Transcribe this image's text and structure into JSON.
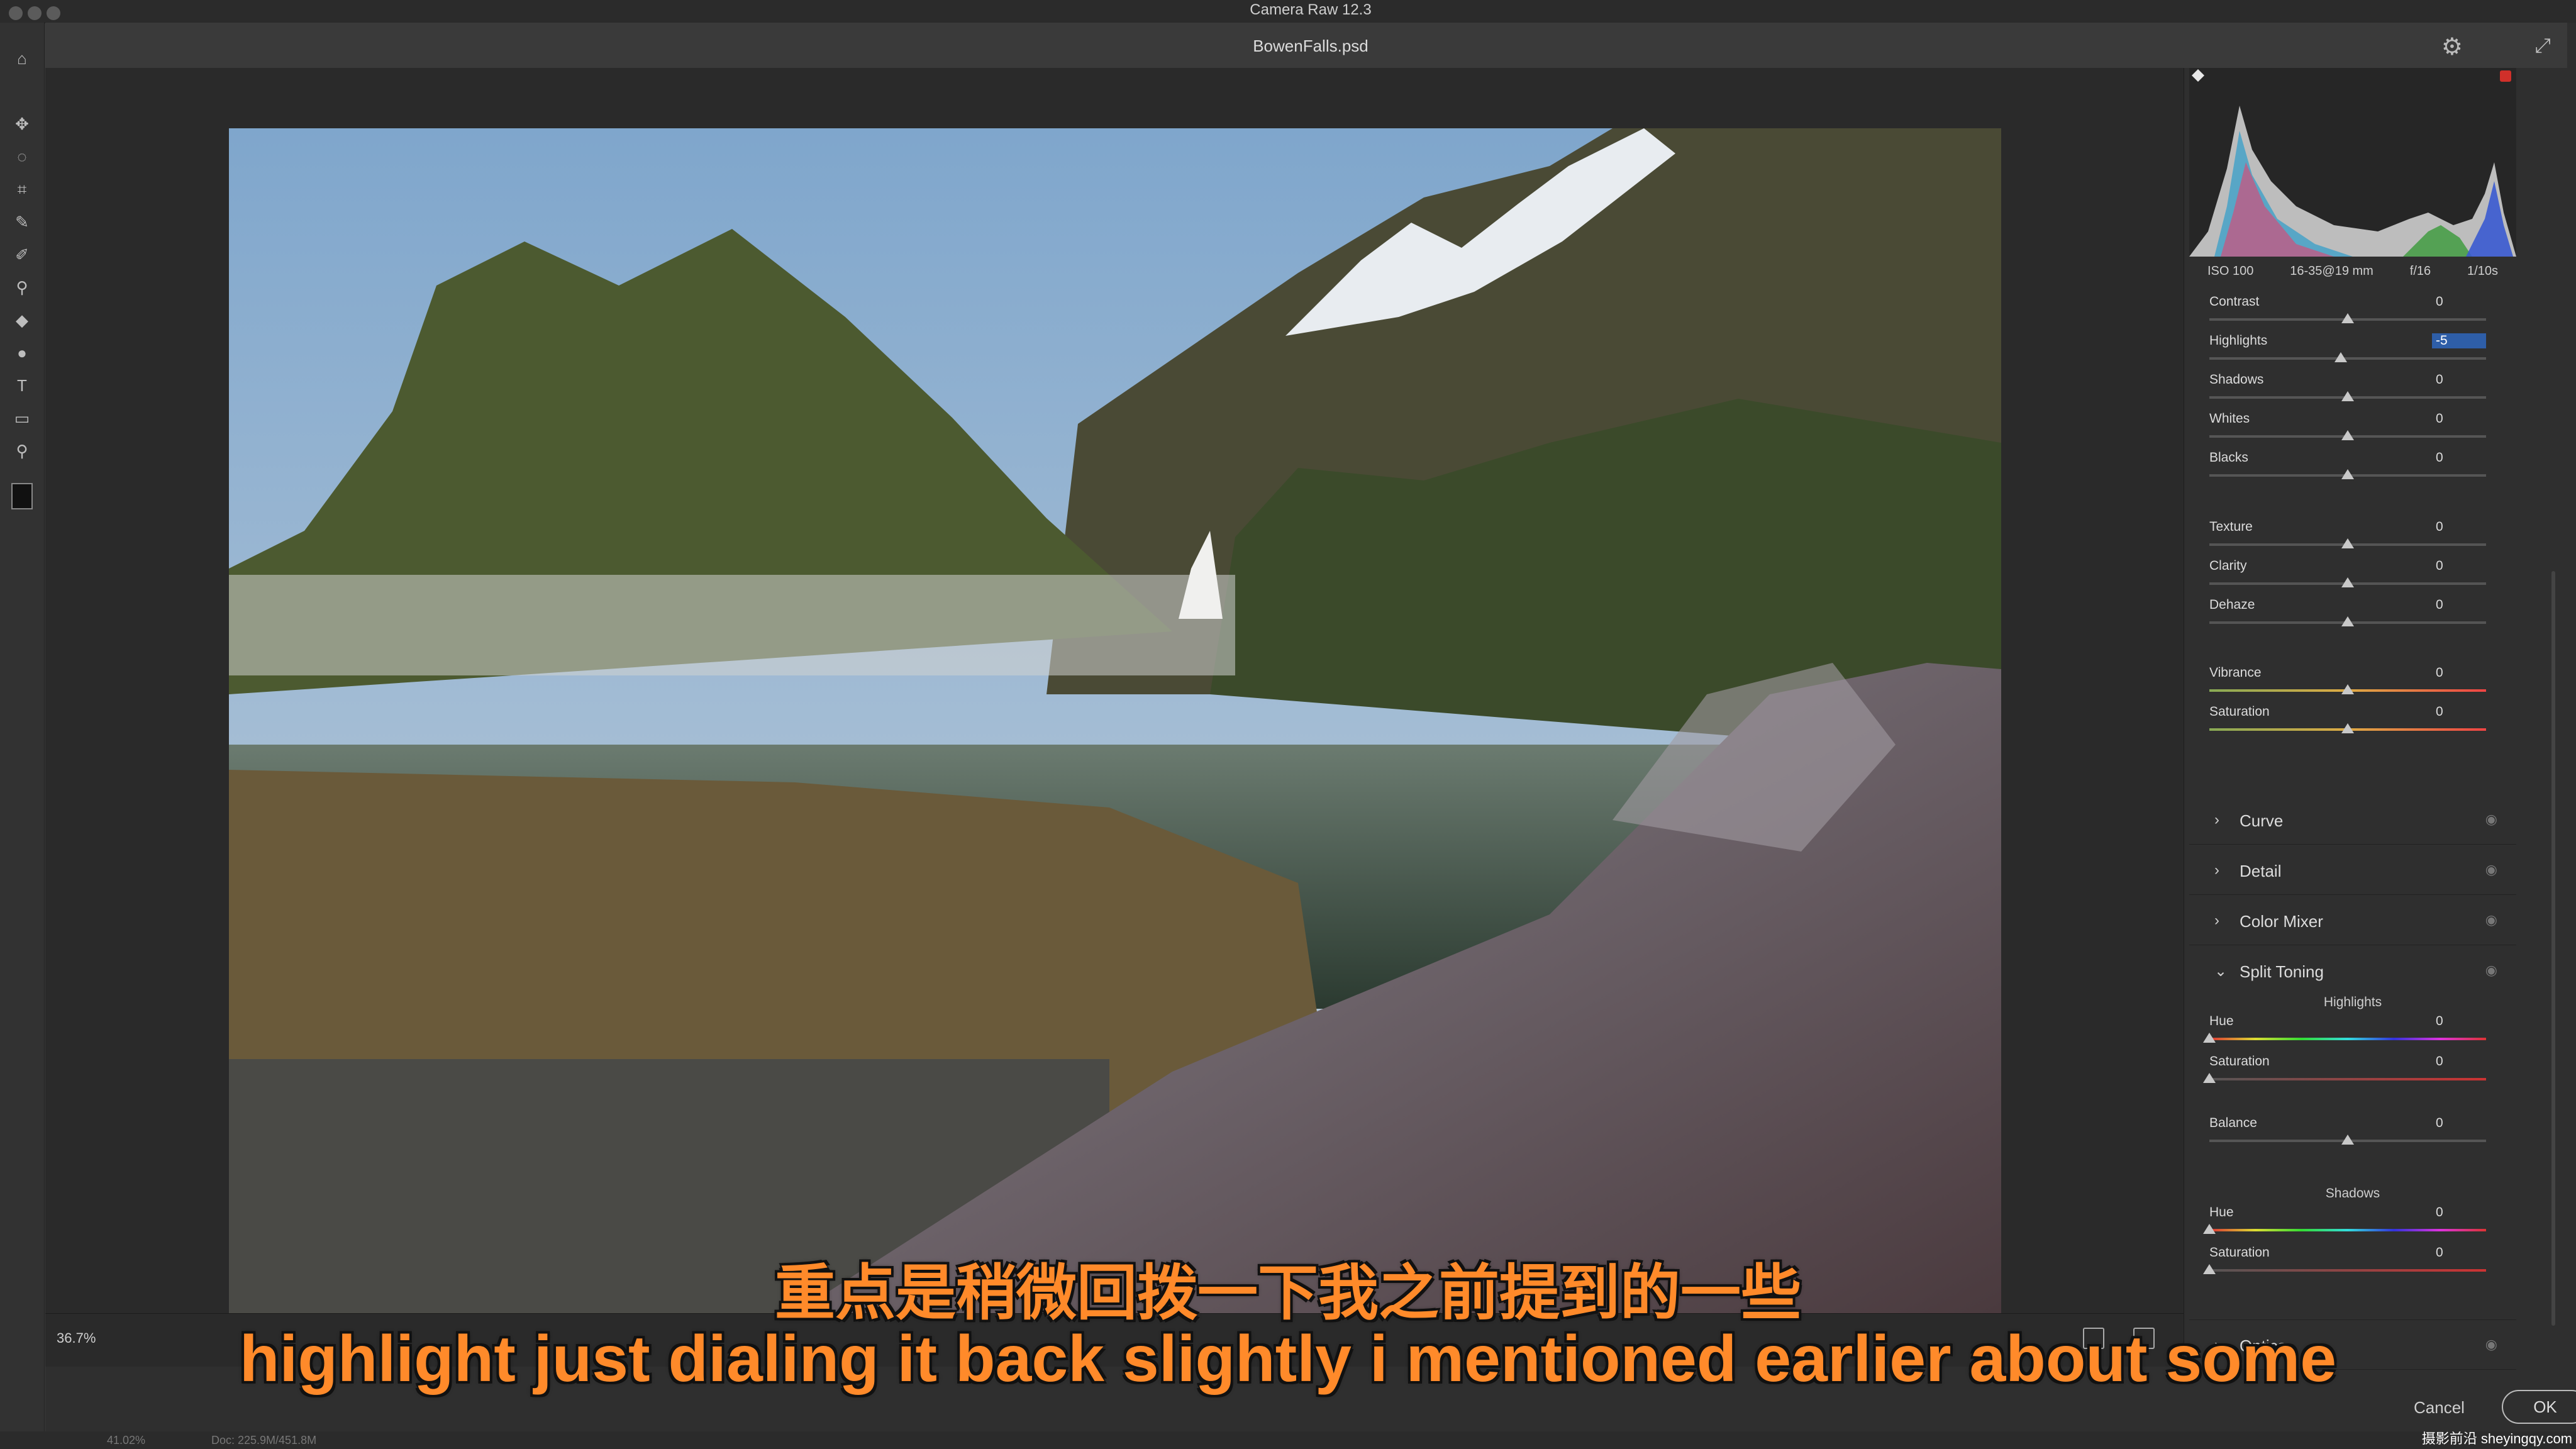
{
  "app": {
    "window_title": "Camera Raw 12.3",
    "document_title": "BowenFalls.psd"
  },
  "exif": {
    "iso": "ISO 100",
    "lens": "16-35@19 mm",
    "aperture": "f/16",
    "shutter": "1/10s"
  },
  "basic_sliders": [
    {
      "label": "Contrast",
      "value": "0",
      "level": 0.5
    },
    {
      "label": "Highlights",
      "value": "-5",
      "level": 0.475
    },
    {
      "label": "Shadows",
      "value": "0",
      "level": 0.5
    },
    {
      "label": "Whites",
      "value": "0",
      "level": 0.5
    },
    {
      "label": "Blacks",
      "value": "0",
      "level": 0.5
    },
    {
      "label": "Texture",
      "value": "0",
      "level": 0.5
    },
    {
      "label": "Clarity",
      "value": "0",
      "level": 0.5
    },
    {
      "label": "Dehaze",
      "value": "0",
      "level": 0.5
    },
    {
      "label": "Vibrance",
      "value": "0",
      "level": 0.5
    },
    {
      "label": "Saturation",
      "value": "0",
      "level": 0.5
    }
  ],
  "sections": {
    "curve": "Curve",
    "detail": "Detail",
    "color_mixer": "Color Mixer",
    "split_toning": "Split Toning",
    "optics": "Optics"
  },
  "split_toning": {
    "highlights_heading": "Highlights",
    "highlights": [
      {
        "label": "Hue",
        "value": "0",
        "level": 0.0
      },
      {
        "label": "Saturation",
        "value": "0",
        "level": 0.0
      }
    ],
    "balance": {
      "label": "Balance",
      "value": "0",
      "level": 0.5
    },
    "shadows_heading": "Shadows",
    "shadows": [
      {
        "label": "Hue",
        "value": "0",
        "level": 0.0
      },
      {
        "label": "Saturation",
        "value": "0",
        "level": 0.0
      }
    ]
  },
  "bottom": {
    "zoom": "36.7%"
  },
  "footer": {
    "cancel": "Cancel",
    "ok": "OK"
  },
  "status": {
    "zoom": "41.02%",
    "doc": "Doc: 225.9M/451.8M"
  },
  "subtitles": {
    "cn": "重点是稍微回拨一下我之前提到的一些",
    "en": "highlight just dialing it back slightly i mentioned earlier about some"
  },
  "watermark": "摄影前沿 sheyingqy.com",
  "colors": {
    "subtitle": "#ff8a2a",
    "panel_bg": "#2f2f2f"
  }
}
